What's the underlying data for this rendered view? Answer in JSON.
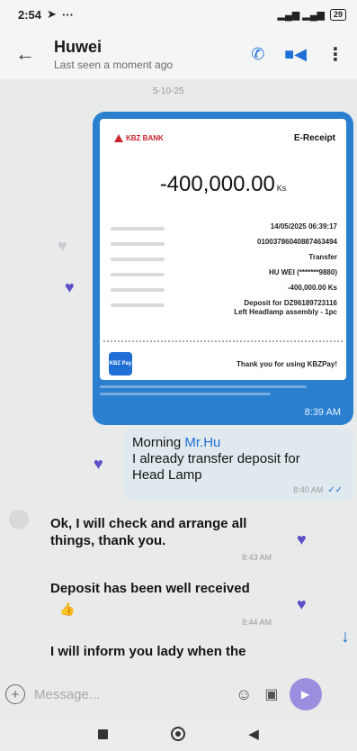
{
  "status_bar": {
    "time": "2:54",
    "signal_text": ".ıl| ᵛᵒˡᵗᵉ .ıl",
    "battery": "29"
  },
  "header": {
    "back_icon": "back-arrow-icon",
    "contact_name": "Huwei",
    "contact_status": "Last seen a moment ago",
    "actions": [
      "phone-icon",
      "video-call-icon",
      "more-vertical-icon"
    ]
  },
  "chat": {
    "date_label": "5-10-25",
    "receipt": {
      "bank": "KBZ BANK",
      "title": "E-Receipt",
      "amount": "-400,000.00",
      "currency": "Ks",
      "rows": [
        {
          "value": "14/05/2025 06:39:17"
        },
        {
          "value": "01003786040887463494"
        },
        {
          "value": "Transfer"
        },
        {
          "value": "HU WEI (*******9880)"
        },
        {
          "value": "-400,000.00 Ks"
        },
        {
          "value": "Deposit for DZ96189723116\nLeft Headlamp assembly - 1pc"
        }
      ],
      "pay_logo": "KBZ Pay",
      "thanks": "Thank you for using KBZPay!",
      "time": "8:39 AM"
    },
    "outgoing": {
      "greeting": "Morning ",
      "mention": "Mr.Hu",
      "rest": "I already transfer deposit for\nHead Lamp",
      "time": "8:40 AM"
    },
    "incoming": [
      {
        "text": "Ok, I will check and arrange all\nthings, thank you.",
        "time": "8:43 AM"
      },
      {
        "text": "Deposit has been well received",
        "time": "8:44 AM"
      },
      {
        "text": "I will inform you lady when the"
      }
    ]
  },
  "composer": {
    "placeholder": "Message...",
    "icons": [
      "add-icon",
      "emoji-icon",
      "sticker-icon",
      "voice-icon"
    ]
  },
  "navbar": {
    "icons": [
      "recent-apps-icon",
      "home-icon",
      "back-triangle-icon"
    ]
  },
  "colors": {
    "accent": "#1f6fd6",
    "receipt_bubble": "#2b7fcf",
    "outgoing_bubble": "#dfe9ee",
    "heart": "#5a50c8"
  }
}
